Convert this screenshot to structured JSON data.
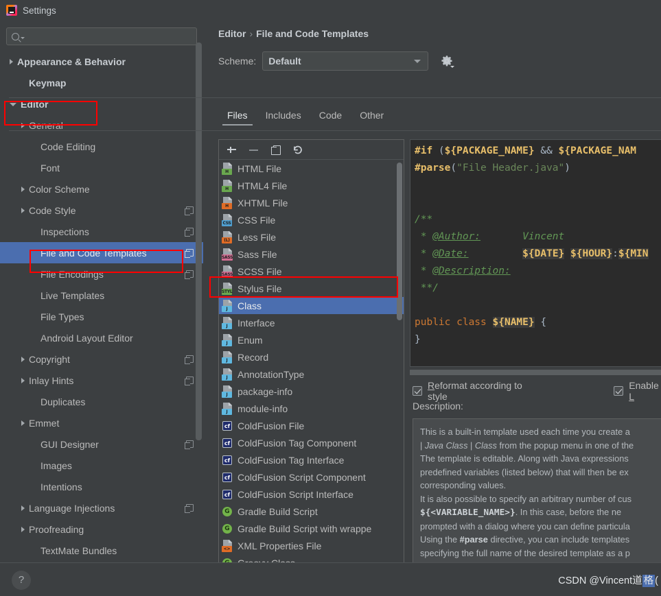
{
  "window": {
    "title": "Settings",
    "logo_icon": "intellij-idea-logo"
  },
  "search": {
    "placeholder": "",
    "value": "",
    "icon": "search-icon"
  },
  "sidebar": {
    "items": [
      {
        "label": "Appearance & Behavior",
        "indent": 0,
        "twisty": "collapsed",
        "bold": true,
        "selected": false,
        "copy": false
      },
      {
        "label": "Keymap",
        "indent": 1,
        "twisty": "none",
        "bold": true,
        "selected": false,
        "copy": false
      },
      {
        "label": "Editor",
        "indent": 0,
        "twisty": "expanded",
        "bold": true,
        "selected": false,
        "copy": false
      },
      {
        "label": "General",
        "indent": 1,
        "twisty": "collapsed",
        "bold": false,
        "selected": false,
        "copy": false
      },
      {
        "label": "Code Editing",
        "indent": 2,
        "twisty": "none",
        "bold": false,
        "selected": false,
        "copy": false
      },
      {
        "label": "Font",
        "indent": 2,
        "twisty": "none",
        "bold": false,
        "selected": false,
        "copy": false
      },
      {
        "label": "Color Scheme",
        "indent": 1,
        "twisty": "collapsed",
        "bold": false,
        "selected": false,
        "copy": false
      },
      {
        "label": "Code Style",
        "indent": 1,
        "twisty": "collapsed",
        "bold": false,
        "selected": false,
        "copy": true
      },
      {
        "label": "Inspections",
        "indent": 2,
        "twisty": "none",
        "bold": false,
        "selected": false,
        "copy": true
      },
      {
        "label": "File and Code Templates",
        "indent": 2,
        "twisty": "none",
        "bold": false,
        "selected": true,
        "copy": true
      },
      {
        "label": "File Encodings",
        "indent": 2,
        "twisty": "none",
        "bold": false,
        "selected": false,
        "copy": true
      },
      {
        "label": "Live Templates",
        "indent": 2,
        "twisty": "none",
        "bold": false,
        "selected": false,
        "copy": false
      },
      {
        "label": "File Types",
        "indent": 2,
        "twisty": "none",
        "bold": false,
        "selected": false,
        "copy": false
      },
      {
        "label": "Android Layout Editor",
        "indent": 2,
        "twisty": "none",
        "bold": false,
        "selected": false,
        "copy": false
      },
      {
        "label": "Copyright",
        "indent": 1,
        "twisty": "collapsed",
        "bold": false,
        "selected": false,
        "copy": true
      },
      {
        "label": "Inlay Hints",
        "indent": 1,
        "twisty": "collapsed",
        "bold": false,
        "selected": false,
        "copy": true
      },
      {
        "label": "Duplicates",
        "indent": 2,
        "twisty": "none",
        "bold": false,
        "selected": false,
        "copy": false
      },
      {
        "label": "Emmet",
        "indent": 1,
        "twisty": "collapsed",
        "bold": false,
        "selected": false,
        "copy": false
      },
      {
        "label": "GUI Designer",
        "indent": 2,
        "twisty": "none",
        "bold": false,
        "selected": false,
        "copy": true
      },
      {
        "label": "Images",
        "indent": 2,
        "twisty": "none",
        "bold": false,
        "selected": false,
        "copy": false
      },
      {
        "label": "Intentions",
        "indent": 2,
        "twisty": "none",
        "bold": false,
        "selected": false,
        "copy": false
      },
      {
        "label": "Language Injections",
        "indent": 1,
        "twisty": "collapsed",
        "bold": false,
        "selected": false,
        "copy": true
      },
      {
        "label": "Proofreading",
        "indent": 1,
        "twisty": "collapsed",
        "bold": false,
        "selected": false,
        "copy": false
      },
      {
        "label": "TextMate Bundles",
        "indent": 2,
        "twisty": "none",
        "bold": false,
        "selected": false,
        "copy": false
      }
    ]
  },
  "breadcrumb": {
    "parent": "Editor",
    "separator": "›",
    "current": "File and Code Templates"
  },
  "scheme": {
    "label": "Scheme:",
    "value": "Default",
    "gear_icon": "gear-icon"
  },
  "tabs": [
    {
      "label": "Files",
      "active": true
    },
    {
      "label": "Includes",
      "active": false
    },
    {
      "label": "Code",
      "active": false
    },
    {
      "label": "Other",
      "active": false
    }
  ],
  "list_toolbar": [
    {
      "icon": "plus-icon",
      "name": "add-template-button"
    },
    {
      "icon": "minus-icon",
      "name": "remove-template-button"
    },
    {
      "icon": "copy-icon",
      "name": "copy-template-button"
    },
    {
      "icon": "revert-icon",
      "name": "reset-template-button"
    }
  ],
  "templates": [
    {
      "label": "HTML File",
      "icon": "html-file-icon",
      "kind": "tag",
      "tag": "H",
      "bg": "#6aa84f",
      "selected": false
    },
    {
      "label": "HTML4 File",
      "icon": "html4-file-icon",
      "kind": "tag",
      "tag": "H",
      "bg": "#6aa84f",
      "selected": false
    },
    {
      "label": "XHTML File",
      "icon": "xhtml-file-icon",
      "kind": "tag",
      "tag": "H",
      "bg": "#e06c26",
      "selected": false
    },
    {
      "label": "CSS File",
      "icon": "css-file-icon",
      "kind": "tag",
      "tag": "CSS",
      "bg": "#4f9fd0",
      "selected": false
    },
    {
      "label": "Less File",
      "icon": "less-file-icon",
      "kind": "tag",
      "tag": "(L)",
      "bg": "#e06c26",
      "selected": false
    },
    {
      "label": "Sass File",
      "icon": "sass-file-icon",
      "kind": "tag",
      "tag": "SASS",
      "bg": "#d26e93",
      "selected": false
    },
    {
      "label": "SCSS File",
      "icon": "scss-file-icon",
      "kind": "tag",
      "tag": "SASS",
      "bg": "#d26e93",
      "selected": false
    },
    {
      "label": "Stylus File",
      "icon": "stylus-file-icon",
      "kind": "tag",
      "tag": "STYL",
      "bg": "#6aa84f",
      "selected": false
    },
    {
      "label": "Class",
      "icon": "java-class-icon",
      "kind": "tag",
      "tag": "J",
      "bg": "#5fb8e0",
      "selected": true
    },
    {
      "label": "Interface",
      "icon": "java-interface-icon",
      "kind": "tag",
      "tag": "J",
      "bg": "#5fb8e0",
      "selected": false
    },
    {
      "label": "Enum",
      "icon": "java-enum-icon",
      "kind": "tag",
      "tag": "J",
      "bg": "#5fb8e0",
      "selected": false
    },
    {
      "label": "Record",
      "icon": "java-record-icon",
      "kind": "tag",
      "tag": "J",
      "bg": "#5fb8e0",
      "selected": false
    },
    {
      "label": "AnnotationType",
      "icon": "java-annotation-icon",
      "kind": "tag",
      "tag": "J",
      "bg": "#5fb8e0",
      "selected": false
    },
    {
      "label": "package-info",
      "icon": "java-package-info-icon",
      "kind": "tag",
      "tag": "J",
      "bg": "#5fb8e0",
      "selected": false
    },
    {
      "label": "module-info",
      "icon": "java-module-info-icon",
      "kind": "tag",
      "tag": "J",
      "bg": "#5fb8e0",
      "selected": false
    },
    {
      "label": "ColdFusion File",
      "icon": "coldfusion-icon",
      "kind": "sq",
      "tag": "cf",
      "bg": "#1f2b6b",
      "fg": "#ffffff",
      "selected": false
    },
    {
      "label": "ColdFusion Tag Component",
      "icon": "coldfusion-icon",
      "kind": "sq",
      "tag": "cf",
      "bg": "#1f2b6b",
      "fg": "#ffffff",
      "selected": false
    },
    {
      "label": "ColdFusion Tag Interface",
      "icon": "coldfusion-icon",
      "kind": "sq",
      "tag": "cf",
      "bg": "#1f2b6b",
      "fg": "#ffffff",
      "selected": false
    },
    {
      "label": "ColdFusion Script Component",
      "icon": "coldfusion-icon",
      "kind": "sq",
      "tag": "cf",
      "bg": "#1f2b6b",
      "fg": "#ffffff",
      "selected": false
    },
    {
      "label": "ColdFusion Script Interface",
      "icon": "coldfusion-icon",
      "kind": "sq",
      "tag": "cf",
      "bg": "#1f2b6b",
      "fg": "#ffffff",
      "selected": false
    },
    {
      "label": "Gradle Build Script",
      "icon": "gradle-icon",
      "kind": "circ",
      "tag": "G",
      "bg": "#73b34a",
      "selected": false
    },
    {
      "label": "Gradle Build Script with wrappe",
      "icon": "gradle-icon",
      "kind": "circ",
      "tag": "G",
      "bg": "#73b34a",
      "selected": false
    },
    {
      "label": "XML Properties File",
      "icon": "xml-properties-icon",
      "kind": "tag",
      "tag": "<>",
      "bg": "#e06c26",
      "selected": false
    },
    {
      "label": "Groovy Class",
      "icon": "groovy-icon",
      "kind": "circ",
      "tag": "G",
      "bg": "#73b34a",
      "selected": false
    }
  ],
  "editor": {
    "lines": [
      "#if (${PACKAGE_NAME} && ${PACKAGE_NAM",
      "#parse(\"File Header.java\")",
      "",
      "",
      "/**",
      " * @Author:        Vincent",
      " * @Date:          ${DATE} ${HOUR}:${MIN",
      " * @Description:",
      " **/",
      "",
      "public class ${NAME} {",
      "}"
    ]
  },
  "options": [
    {
      "label": "Reformat according to style",
      "mnemonic": "R",
      "checked": true,
      "name": "reformat-checkbox"
    },
    {
      "label": "Enable L",
      "mnemonic": "L",
      "checked": true,
      "name": "enable-live-templates-checkbox"
    }
  ],
  "description": {
    "label": "Description:",
    "text": "This is a built-in template used each time you create a\n| Java Class | Class from the popup menu in one of the\nThe template is editable. Along with Java expressions\npredefined variables (listed below) that will then be ex\ncorresponding values.\nIt is also possible to specify an arbitrary number of cus\n${<VARIABLE_NAME>}. In this case, before the ne\nprompted with a dialog where you can define particula\nUsing the #parse directive, you can include templates\nspecifying the full name of the desired template as a p\nexample:\n#parse(\"File Header.java\")"
  },
  "bottom": {
    "help_icon": "help-icon",
    "watermark_main": "CSDN @Vincent道",
    "watermark_highlight": "格",
    "watermark_tail": "("
  },
  "colors": {
    "accent_selection": "#4b6eaf",
    "window_bg": "#3c3f41",
    "editor_bg": "#2b2b2b",
    "annotation_red": "#ff0000"
  }
}
